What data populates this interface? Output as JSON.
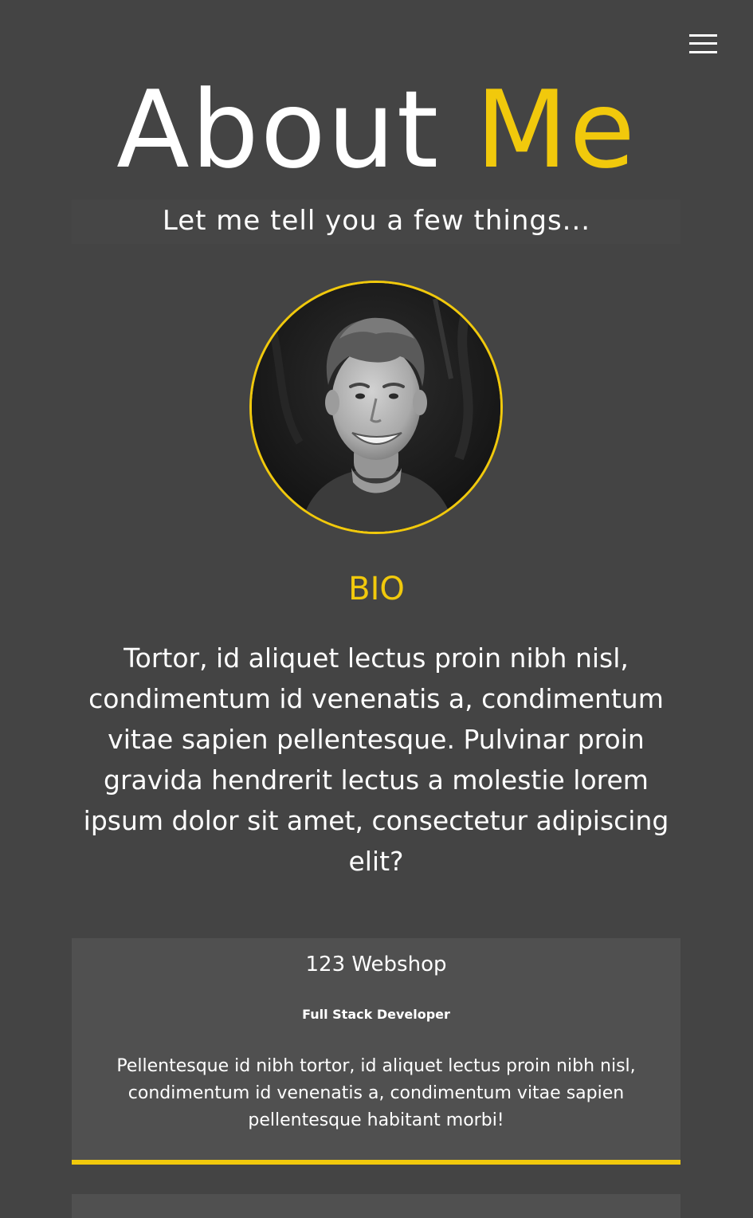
{
  "header": {
    "menu_icon": "hamburger-menu-icon"
  },
  "hero": {
    "title_part1": "About",
    "title_part2": "Me",
    "subtitle": "Let me tell you a few things..."
  },
  "profile": {
    "photo": "smiling-man-portrait-photo"
  },
  "bio": {
    "heading": "BIO",
    "text": "Tortor, id aliquet lectus proin nibh nisl, condimentum id venenatis a, condimentum vitae sapien pellentesque. Pulvinar proin gravida hendrerit lectus a molestie lorem ipsum dolor sit amet, consectetur adipiscing elit?"
  },
  "experience": [
    {
      "company": "123 Webshop",
      "role": "Full Stack Developer",
      "description": "Pellentesque id nibh tortor, id aliquet lectus proin nibh nisl, condimentum id venenatis a, condimentum vitae sapien pellentesque habitant morbi!"
    }
  ],
  "colors": {
    "background": "#444444",
    "accent": "#f1c90c",
    "card": "#505050",
    "text": "#ffffff"
  }
}
